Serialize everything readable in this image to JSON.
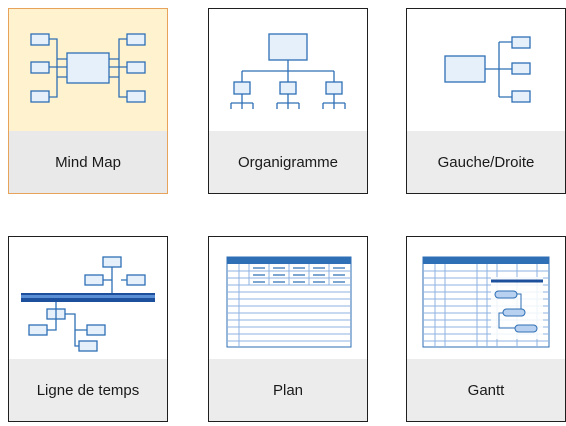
{
  "templates": [
    {
      "id": "mindmap",
      "label": "Mind Map",
      "icon": "mind-map-icon",
      "selected": true
    },
    {
      "id": "orgchart",
      "label": "Organigramme",
      "icon": "org-chart-icon",
      "selected": false
    },
    {
      "id": "leftright",
      "label": "Gauche/Droite",
      "icon": "left-right-icon",
      "selected": false
    },
    {
      "id": "timeline",
      "label": "Ligne de temps",
      "icon": "timeline-icon",
      "selected": false
    },
    {
      "id": "plan",
      "label": "Plan",
      "icon": "plan-icon",
      "selected": false
    },
    {
      "id": "gantt",
      "label": "Gantt",
      "icon": "gantt-icon",
      "selected": false
    }
  ],
  "colors": {
    "icon_stroke": "#2e6fb5",
    "icon_fill": "#e6f0fb",
    "selected_bg": "#fff3cf",
    "selected_border": "#e8a35a",
    "label_bg": "#ececec"
  }
}
